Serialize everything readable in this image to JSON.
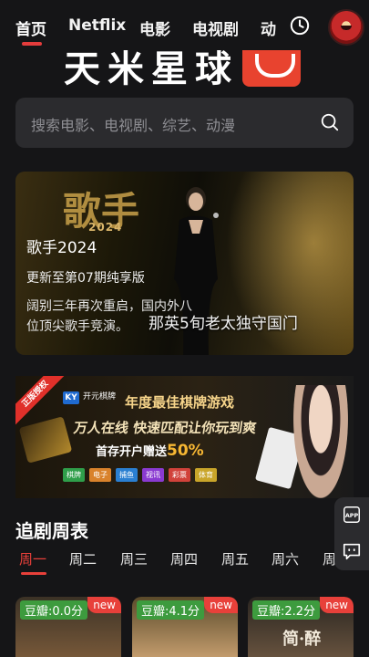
{
  "nav": {
    "tabs": [
      "首页",
      "Netflix",
      "电影",
      "电视剧",
      "动"
    ],
    "active_tab": 0
  },
  "logo": {
    "text": "天米星球"
  },
  "search": {
    "placeholder": "搜索电影、电视剧、综艺、动漫"
  },
  "banner": {
    "art_title": "歌手",
    "art_year": "2024",
    "title": "歌手2024",
    "update": "更新至第07期纯享版",
    "description": "阔别三年再次重启，国内外八位顶尖歌手竞演。",
    "overlay": "那英5旬老太独守国门"
  },
  "ad": {
    "ribbon": "正版授权",
    "brand_logo": "KY",
    "brand_name": "开元棋牌",
    "title": "年度最佳棋牌游戏",
    "slogan": "万人在线 快速匹配让你玩到爽",
    "bonus_text": "首存开户赠送",
    "bonus_pct": "50%",
    "tags": [
      {
        "label": "棋牌",
        "color": "#2f9e4a"
      },
      {
        "label": "电子",
        "color": "#d9822b"
      },
      {
        "label": "捕鱼",
        "color": "#2a7fd1"
      },
      {
        "label": "视讯",
        "color": "#8a3ad1"
      },
      {
        "label": "彩票",
        "color": "#d1423a"
      },
      {
        "label": "体育",
        "color": "#c9a52a"
      }
    ]
  },
  "schedule": {
    "title": "追剧周表",
    "days": [
      "周一",
      "周二",
      "周三",
      "周四",
      "周五",
      "周六",
      "周日"
    ],
    "active_day": 0
  },
  "cards": [
    {
      "score": "豆瓣:0.0分",
      "badge": "new",
      "colors": [
        "#3b3226",
        "#7a5a3a"
      ]
    },
    {
      "score": "豆瓣:4.1分",
      "badge": "new",
      "colors": [
        "#5a4a2a",
        "#c8a070"
      ]
    },
    {
      "score": "豆瓣:2.2分",
      "badge": "new",
      "colors": [
        "#2a2520",
        "#6a5540"
      ],
      "poster_text": "简·醉"
    }
  ],
  "side": {
    "app_label": "APP"
  },
  "colors": {
    "accent": "#e8403a",
    "background": "#151517",
    "surface": "#2b2b2e",
    "score_green": "#3d9b3e"
  }
}
